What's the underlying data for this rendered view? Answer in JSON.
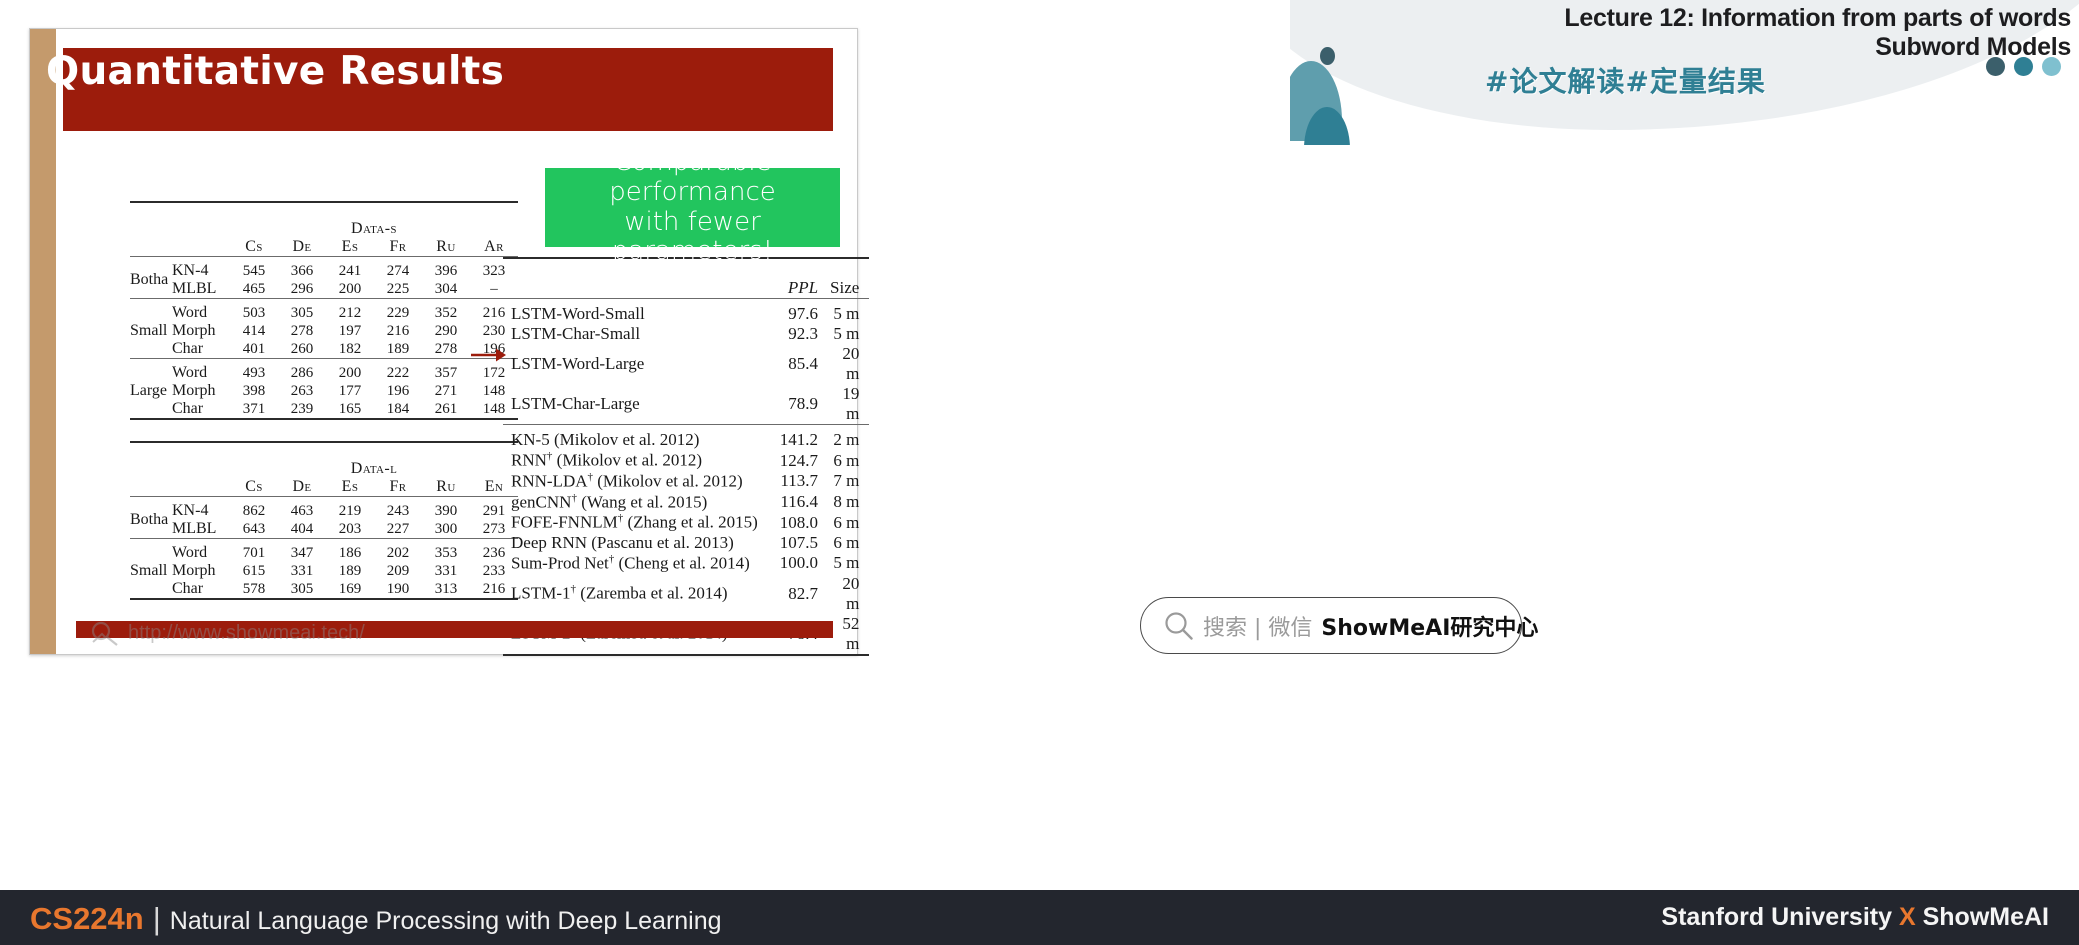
{
  "header": {
    "title_line1": "Lecture 12: Information from parts of words",
    "title_line2": "Subword Models",
    "chinese_tag": "#论文解读#定量结果",
    "dots": [
      "#3b5f6b",
      "#2f7f94",
      "#7fc0cf"
    ],
    "blob_colors": {
      "big": "#5f9ead",
      "small": "#2f7f94",
      "dot": "#3b5f6b"
    }
  },
  "slide": {
    "title": "Quantitative Results",
    "title_bar_color": "#9c1c0c",
    "side_stripe_color": "#c49a6c",
    "watermark_url": "http://www.showmeai.tech/",
    "callout": {
      "line1": "Comparable performance",
      "line2": "with fewer parameters!",
      "bg_color": "#22c55e",
      "text_color": "#ffffff"
    },
    "arrow": {
      "color": "#9c1c0c",
      "points_to": "LSTM-Char-Large"
    }
  },
  "table_data_s": {
    "caption": "Data-s",
    "columns": [
      "Cs",
      "De",
      "Es",
      "Fr",
      "Ru",
      "Ar"
    ],
    "groups": [
      {
        "name": "Botha",
        "rows": [
          {
            "label": "KN-4",
            "values": [
              "545",
              "366",
              "241",
              "274",
              "396",
              "323"
            ],
            "bold": []
          },
          {
            "label": "MLBL",
            "values": [
              "465",
              "296",
              "200",
              "225",
              "304",
              "–"
            ],
            "bold": []
          }
        ]
      },
      {
        "name": "Small",
        "rows": [
          {
            "label": "Word",
            "values": [
              "503",
              "305",
              "212",
              "229",
              "352",
              "216"
            ],
            "bold": []
          },
          {
            "label": "Morph",
            "values": [
              "414",
              "278",
              "197",
              "216",
              "290",
              "230"
            ],
            "bold": []
          },
          {
            "label": "Char",
            "values": [
              "401",
              "260",
              "182",
              "189",
              "278",
              "196"
            ],
            "bold": []
          }
        ]
      },
      {
        "name": "Large",
        "rows": [
          {
            "label": "Word",
            "values": [
              "493",
              "286",
              "200",
              "222",
              "357",
              "172"
            ],
            "bold": []
          },
          {
            "label": "Morph",
            "values": [
              "398",
              "263",
              "177",
              "196",
              "271",
              "148"
            ],
            "bold": [
              5
            ]
          },
          {
            "label": "Char",
            "values": [
              "371",
              "239",
              "165",
              "184",
              "261",
              "148"
            ],
            "bold": [
              0,
              1,
              2,
              3,
              4,
              5
            ]
          }
        ]
      }
    ]
  },
  "table_data_l": {
    "caption": "Data-l",
    "columns": [
      "Cs",
      "De",
      "Es",
      "Fr",
      "Ru",
      "En"
    ],
    "groups": [
      {
        "name": "Botha",
        "rows": [
          {
            "label": "KN-4",
            "values": [
              "862",
              "463",
              "219",
              "243",
              "390",
              "291"
            ],
            "bold": []
          },
          {
            "label": "MLBL",
            "values": [
              "643",
              "404",
              "203",
              "227",
              "300",
              "273"
            ],
            "bold": [
              4
            ]
          }
        ]
      },
      {
        "name": "Small",
        "rows": [
          {
            "label": "Word",
            "values": [
              "701",
              "347",
              "186",
              "202",
              "353",
              "236"
            ],
            "bold": []
          },
          {
            "label": "Morph",
            "values": [
              "615",
              "331",
              "189",
              "209",
              "331",
              "233"
            ],
            "bold": []
          },
          {
            "label": "Char",
            "values": [
              "578",
              "305",
              "169",
              "190",
              "313",
              "216"
            ],
            "bold": [
              0,
              1,
              2,
              3,
              5
            ]
          }
        ]
      }
    ]
  },
  "table_ppl": {
    "columns": [
      "PPL",
      "Size"
    ],
    "section_own": [
      {
        "name": "LSTM-Word-Small",
        "ppl": "97.6",
        "size": "5 m"
      },
      {
        "name": "LSTM-Char-Small",
        "ppl": "92.3",
        "size": "5 m"
      },
      {
        "name": "LSTM-Word-Large",
        "ppl": "85.4",
        "size": "20 m"
      },
      {
        "name": "LSTM-Char-Large",
        "ppl": "78.9",
        "size": "19 m"
      }
    ],
    "section_baselines": [
      {
        "name": "KN-5 (Mikolov et al. 2012)",
        "dagger": false,
        "ppl": "141.2",
        "size": "2 m"
      },
      {
        "name": "RNN",
        "suffix": " (Mikolov et al. 2012)",
        "dagger": true,
        "ppl": "124.7",
        "size": "6 m"
      },
      {
        "name": "RNN-LDA",
        "suffix": " (Mikolov et al. 2012)",
        "dagger": true,
        "ppl": "113.7",
        "size": "7 m"
      },
      {
        "name": "genCNN",
        "suffix": " (Wang et al. 2015)",
        "dagger": true,
        "ppl": "116.4",
        "size": "8 m"
      },
      {
        "name": "FOFE-FNNLM",
        "suffix": " (Zhang et al. 2015)",
        "dagger": true,
        "ppl": "108.0",
        "size": "6 m"
      },
      {
        "name": "Deep RNN (Pascanu et al. 2013)",
        "dagger": false,
        "ppl": "107.5",
        "size": "6 m"
      },
      {
        "name": "Sum-Prod Net",
        "suffix": " (Cheng et al. 2014)",
        "dagger": true,
        "ppl": "100.0",
        "size": "5 m"
      },
      {
        "name": "LSTM-1",
        "suffix": " (Zaremba et al. 2014)",
        "dagger": true,
        "ppl": "82.7",
        "size": "20 m"
      },
      {
        "name": "LSTM-2",
        "suffix": " (Zaremba et al. 2014)",
        "dagger": true,
        "ppl": "78.4",
        "size": "52 m"
      }
    ]
  },
  "search": {
    "icon": "search-icon",
    "placeholder": "搜索 | 微信",
    "brand": "ShowMeAI研究中心"
  },
  "footer": {
    "course_code": "CS224n",
    "separator": "|",
    "course_name": "Natural Language Processing with Deep Learning",
    "right_pre": "Stanford University ",
    "right_x": "X",
    "right_post": " ShowMeAI",
    "bg_color": "#23262e",
    "accent_color": "#e8772e"
  }
}
